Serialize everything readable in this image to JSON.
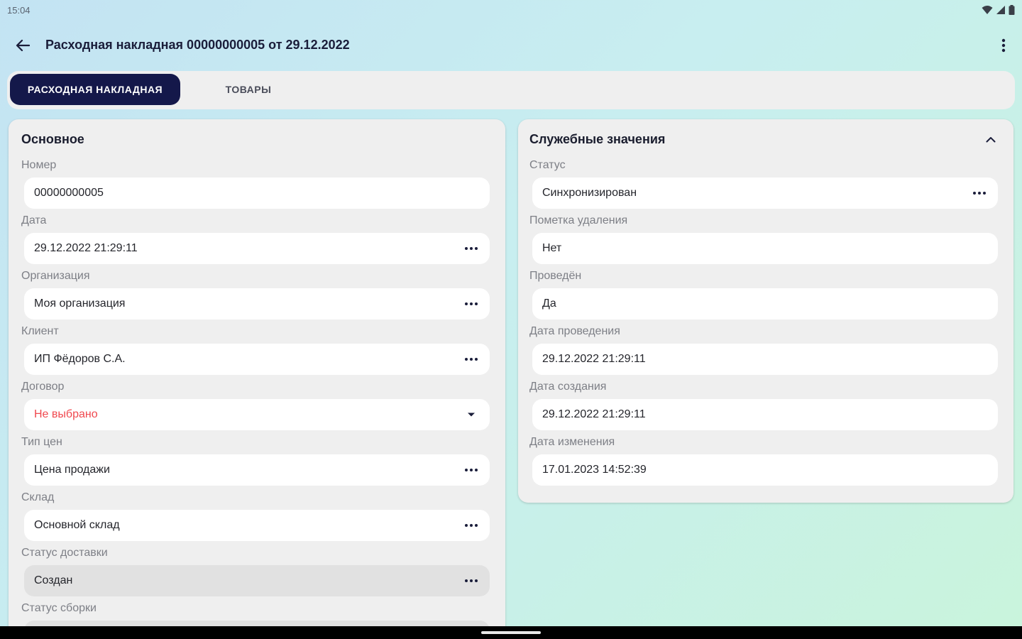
{
  "status_bar": {
    "time": "15:04",
    "icons": [
      "wifi-icon",
      "signal-icon",
      "battery-icon"
    ]
  },
  "app_bar": {
    "title": "Расходная накладная 00000000005 от 29.12.2022",
    "back_icon": "arrow-left-icon",
    "menu_icon": "more-vertical-icon"
  },
  "tabs": [
    {
      "label": "РАСХОДНАЯ НАКЛАДНАЯ",
      "active": true
    },
    {
      "label": "ТОВАРЫ",
      "active": false
    }
  ],
  "main_card": {
    "title": "Основное",
    "fields": [
      {
        "label": "Номер",
        "value": "00000000005",
        "action": "none"
      },
      {
        "label": "Дата",
        "value": "29.12.2022 21:29:11",
        "action": "more-horizontal-icon"
      },
      {
        "label": "Организация",
        "value": "Моя организация",
        "action": "more-horizontal-icon"
      },
      {
        "label": "Клиент",
        "value": "ИП Фёдоров С.А.",
        "action": "more-horizontal-icon"
      },
      {
        "label": "Договор",
        "value": "Не выбрано",
        "action": "dropdown-arrow-icon",
        "value_color": "#f0484e"
      },
      {
        "label": "Тип цен",
        "value": "Цена продажи",
        "action": "more-horizontal-icon"
      },
      {
        "label": "Склад",
        "value": "Основной склад",
        "action": "more-horizontal-icon"
      },
      {
        "label": "Статус доставки",
        "value": "Создан",
        "action": "more-horizontal-icon",
        "disabled": true
      },
      {
        "label": "Статус сборки",
        "value": "",
        "action": "none"
      }
    ]
  },
  "service_card": {
    "title": "Служебные значения",
    "collapse_icon": "chevron-up-icon",
    "fields": [
      {
        "label": "Статус",
        "value": "Синхронизирован",
        "action": "more-horizontal-icon"
      },
      {
        "label": "Пометка удаления",
        "value": "Нет",
        "action": "none"
      },
      {
        "label": "Проведён",
        "value": "Да",
        "action": "none"
      },
      {
        "label": "Дата проведения",
        "value": "29.12.2022 21:29:11",
        "action": "none"
      },
      {
        "label": "Дата создания",
        "value": "29.12.2022 21:29:11",
        "action": "none"
      },
      {
        "label": "Дата изменения",
        "value": "17.01.2023 14:52:39",
        "action": "none"
      }
    ]
  },
  "colors": {
    "accent": "#14184a",
    "error": "#f0484e",
    "card_bg": "#efefef",
    "field_bg": "#ffffff"
  }
}
